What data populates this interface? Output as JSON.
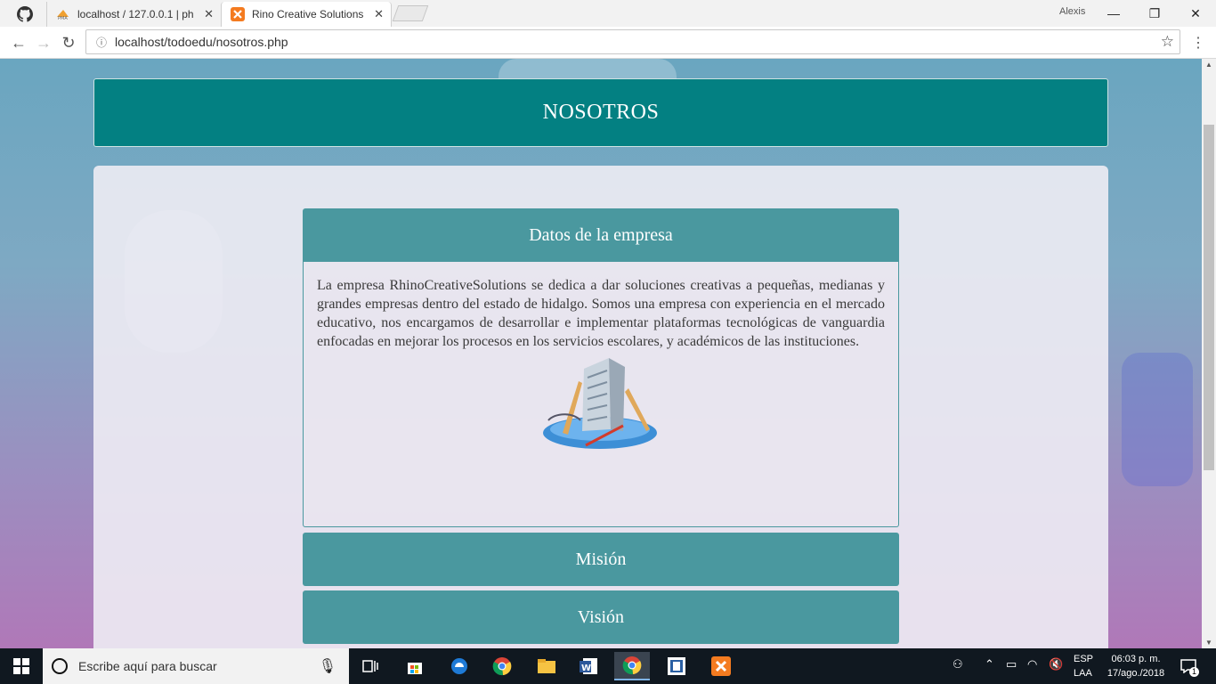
{
  "browser": {
    "tabs": [
      {
        "label": "",
        "icon": "github-icon"
      },
      {
        "label": "localhost / 127.0.0.1 | php",
        "icon": "phpmyadmin-icon"
      },
      {
        "label": "Rino Creative Solutions",
        "icon": "xampp-icon",
        "active": true
      }
    ],
    "user": "Alexis",
    "url": "localhost/todoedu/nosotros.php"
  },
  "page": {
    "header_title": "NOSOTROS",
    "accordion": [
      {
        "title": "Datos de la empresa",
        "expanded": true,
        "body": "La empresa RhinoCreativeSolutions se dedica a dar soluciones creativas a pequeñas, medianas y grandes empresas dentro del estado de hidalgo. Somos una empresa con experiencia en el mercado educativo, nos encargamos de desarrollar e implementar plataformas tecnológicas de vanguardia enfocadas en mejorar los procesos en los servicios escolares, y académicos de las instituciones."
      },
      {
        "title": "Misión",
        "expanded": false
      },
      {
        "title": "Visión",
        "expanded": false
      }
    ]
  },
  "taskbar": {
    "search_placeholder": "Escribe aquí para buscar",
    "language_top": "ESP",
    "language_bottom": "LAA",
    "time": "06:03 p. m.",
    "date": "17/ago./2018",
    "notification_count": "1"
  },
  "colors": {
    "header_teal": "#038082",
    "accordion_teal": "#4a989f"
  }
}
